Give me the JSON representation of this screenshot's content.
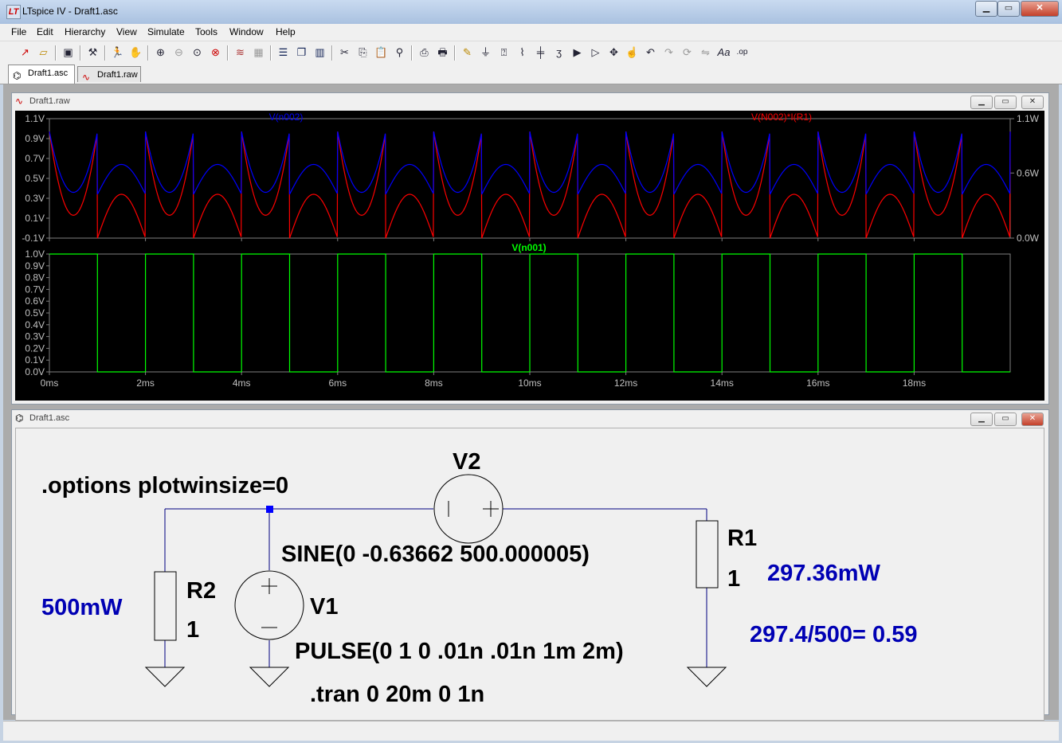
{
  "window": {
    "title": "LTspice IV - Draft1.asc",
    "logo": "LT",
    "minimize": "▁",
    "maximize": "▭",
    "close": "✕"
  },
  "menu": [
    "File",
    "Edit",
    "Hierarchy",
    "View",
    "Simulate",
    "Tools",
    "Window",
    "Help"
  ],
  "toolbar_icons": [
    "new-schematic-icon",
    "open-icon",
    "save-icon",
    "control-panel-icon",
    "run-icon",
    "halt-icon",
    "zoom-in-icon",
    "zoom-out-icon",
    "zoom-fit-icon",
    "zoom-cancel-icon",
    "autorange-icon",
    "plot-settings-icon",
    "tile-horizontal-icon",
    "cascade-icon",
    "tile-vertical-icon",
    "cut-icon",
    "copy-icon",
    "paste-icon",
    "find-icon",
    "print-setup-icon",
    "print-icon",
    "wire-icon",
    "ground-icon",
    "label-icon",
    "resistor-icon",
    "capacitor-icon",
    "inductor-icon",
    "diode-icon",
    "component-icon",
    "move-icon",
    "drag-icon",
    "undo-icon",
    "redo-icon",
    "rotate-icon",
    "mirror-icon",
    "text-icon",
    "spice-directive-icon"
  ],
  "tabs": [
    {
      "label": "Draft1.asc",
      "icon": "schematic-icon",
      "active": true
    },
    {
      "label": "Draft1.raw",
      "icon": "waveform-icon",
      "active": false
    }
  ],
  "plot_window": {
    "title": "Draft1.raw",
    "colors": {
      "bg": "#000000",
      "grid": "#7f7f7f",
      "blue": "#0000ff",
      "red": "#ff0000",
      "green": "#00ff00",
      "label": "#c0c0c0"
    }
  },
  "schematic_window": {
    "title": "Draft1.asc",
    "options_directive": ".options plotwinsize=0",
    "tran_directive": ".tran 0 20m 0 1n",
    "V1": {
      "name": "V1",
      "value": "PULSE(0 1 0 .01n .01n 1m 2m)"
    },
    "V2": {
      "name": "V2",
      "value": "SINE(0 -0.63662 500.000005)"
    },
    "R1": {
      "name": "R1",
      "value": "1"
    },
    "R2": {
      "name": "R2",
      "value": "1"
    },
    "annotations": {
      "r2_power": "500mW",
      "r1_power": "297.36mW",
      "ratio": "297.4/500= 0.59",
      "color": "#0000b4"
    }
  },
  "chart_data": [
    {
      "type": "line",
      "pane": "top",
      "series": [
        {
          "name": "V(n002)",
          "color": "#0000ff",
          "description_values": {
            "peak": 0.97,
            "dip_low": 0.36,
            "hump": 0.64
          }
        },
        {
          "name": "V(N002)*I(R1)",
          "color": "#ff0000",
          "description_values": {
            "peak": 0.97,
            "dip_low": 0.13,
            "hump": 0.41
          }
        }
      ],
      "left_ticks": [
        "1.1V",
        "0.9V",
        "0.7V",
        "0.5V",
        "0.3V",
        "0.1V",
        "-0.1V"
      ],
      "right_ticks": [
        "1.1W",
        "0.6W",
        "0.0W"
      ],
      "x_ticks": [
        "0ms",
        "2ms",
        "4ms",
        "6ms",
        "8ms",
        "10ms",
        "12ms",
        "14ms",
        "16ms",
        "18ms"
      ],
      "x_range": [
        0,
        20
      ],
      "y_range": [
        -0.1,
        1.1
      ]
    },
    {
      "type": "line",
      "pane": "bottom",
      "series": [
        {
          "name": "V(n001)",
          "color": "#00ff00",
          "period_ms": 2,
          "high": 1.0,
          "low": 0.0,
          "duty": 0.5
        }
      ],
      "left_ticks": [
        "1.0V",
        "0.9V",
        "0.8V",
        "0.7V",
        "0.6V",
        "0.5V",
        "0.4V",
        "0.3V",
        "0.2V",
        "0.1V",
        "0.0V"
      ],
      "x_range": [
        0,
        20
      ],
      "y_range": [
        0,
        1
      ]
    }
  ]
}
